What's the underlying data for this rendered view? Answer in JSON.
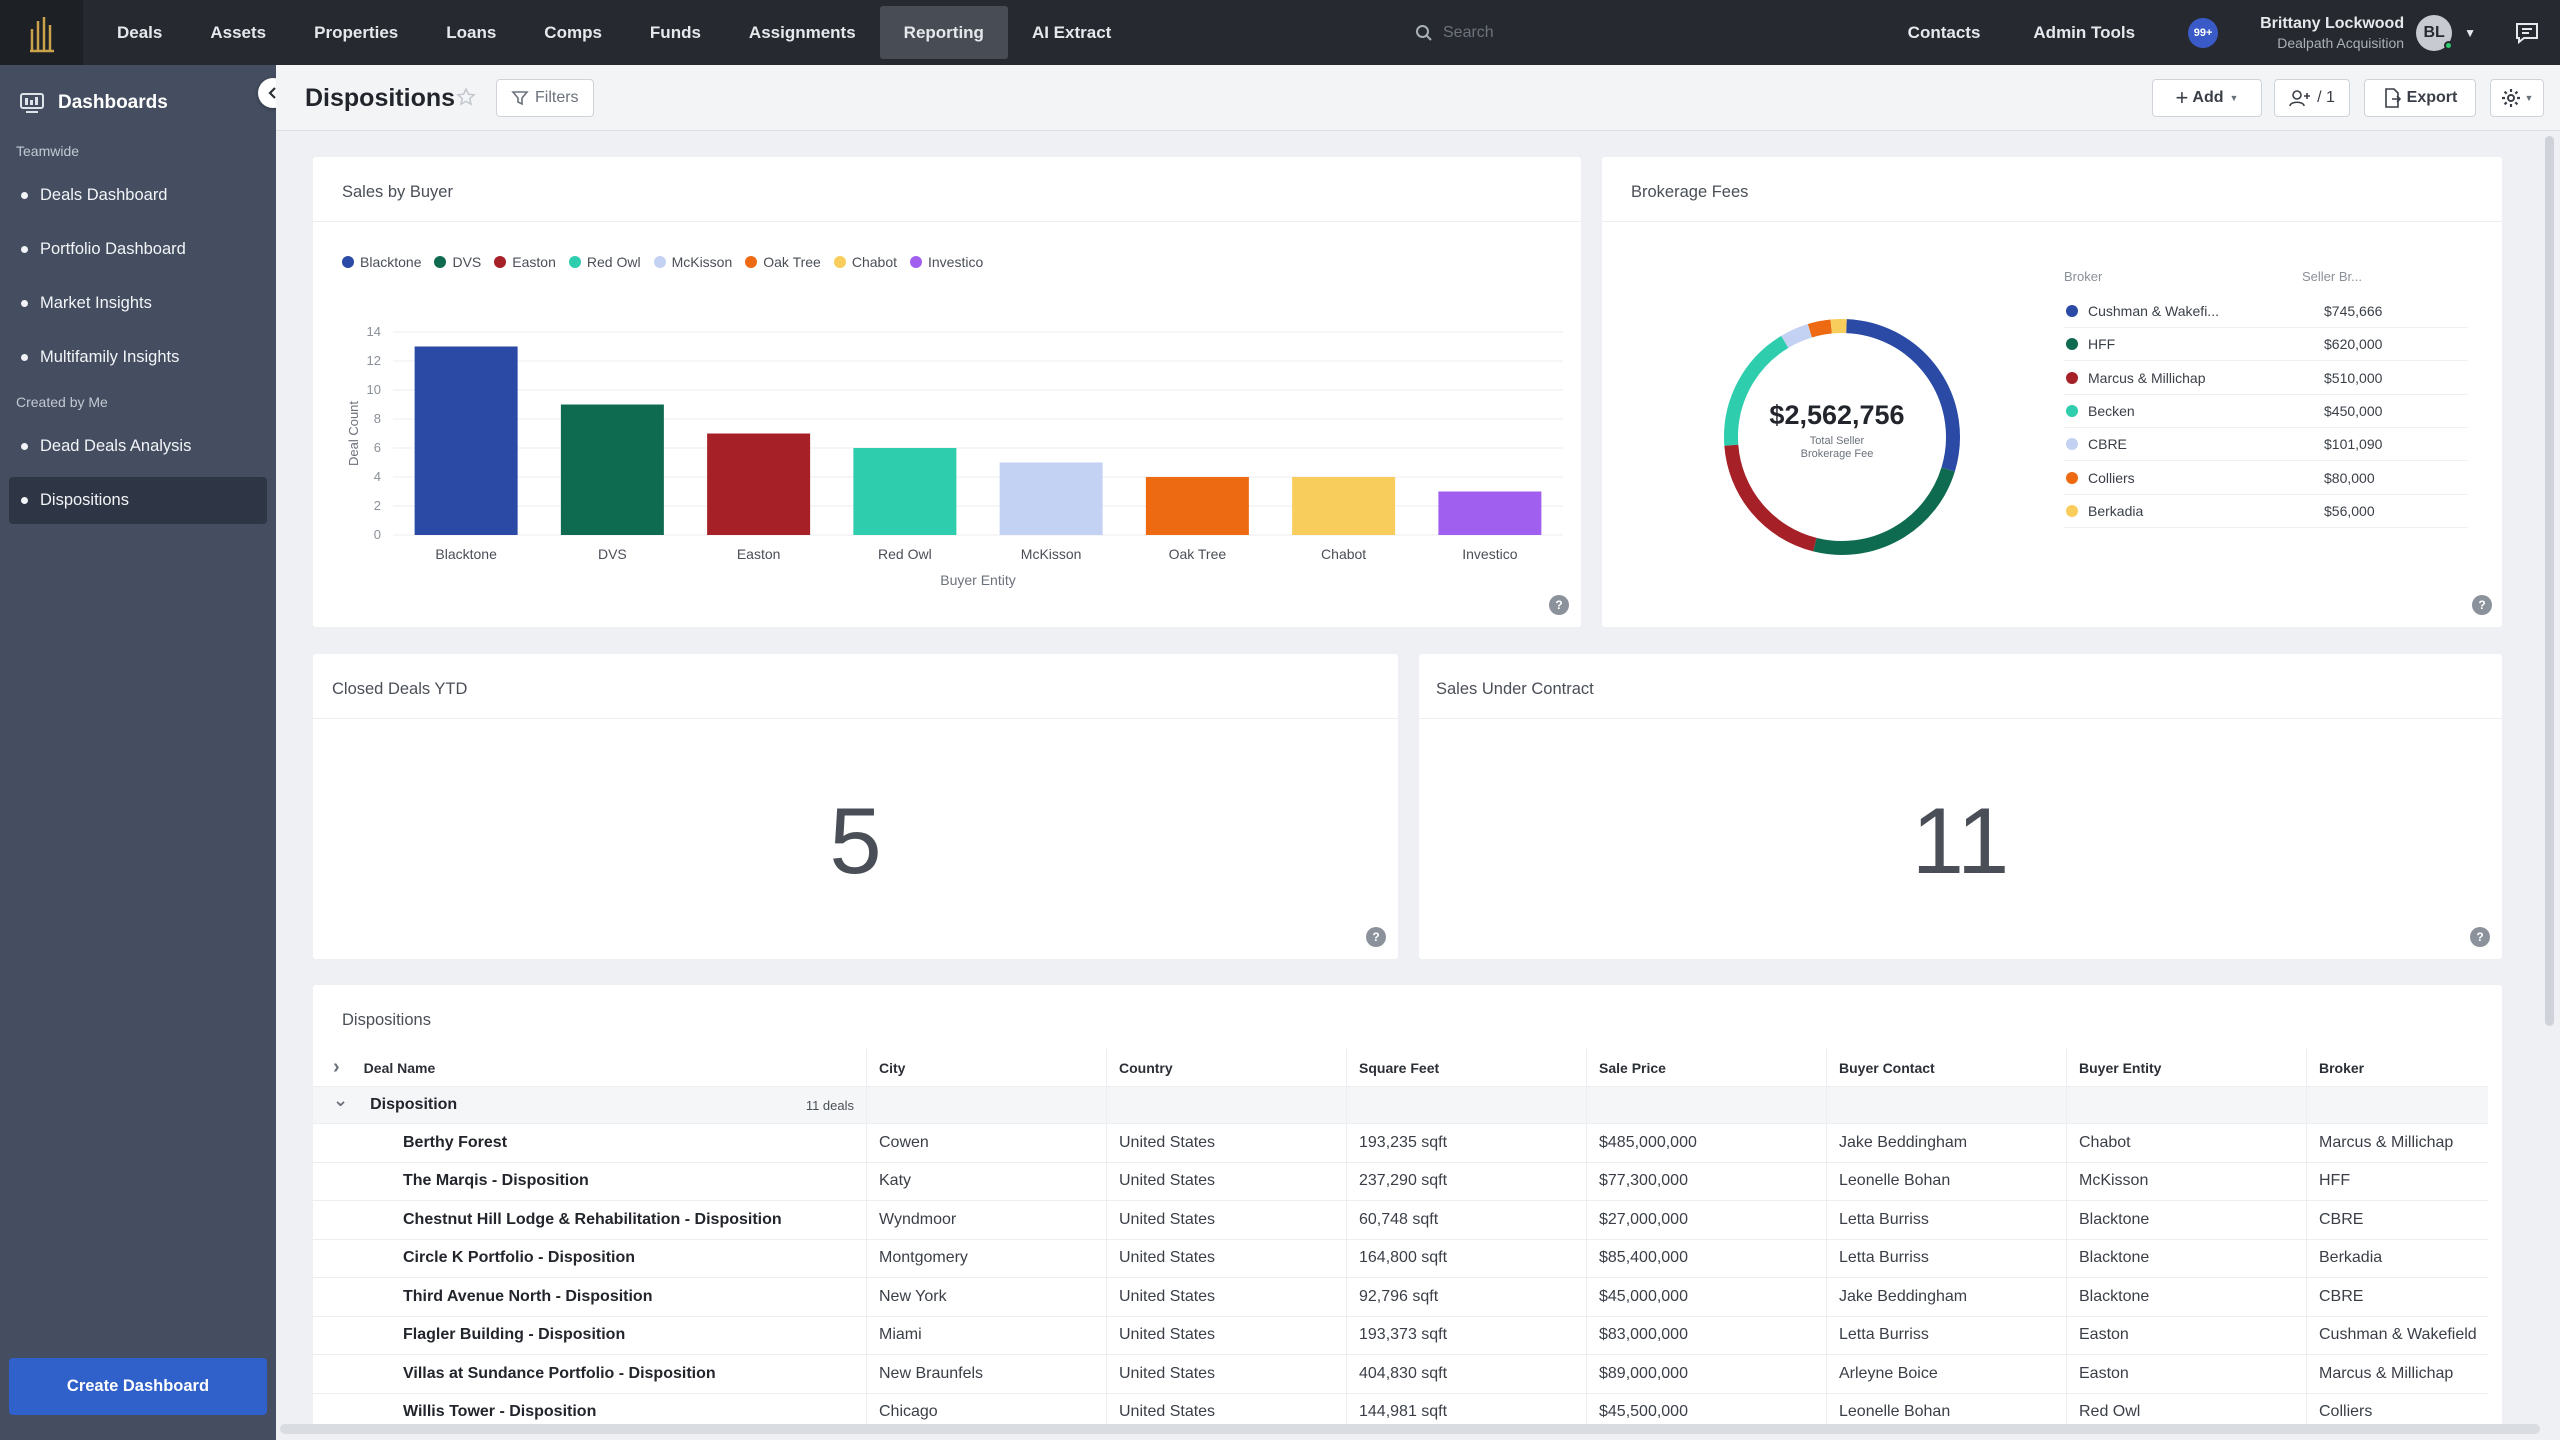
{
  "nav": {
    "items": [
      "Deals",
      "Assets",
      "Properties",
      "Loans",
      "Comps",
      "Funds",
      "Assignments",
      "Reporting",
      "AI Extract"
    ],
    "active": "Reporting",
    "search_placeholder": "Search",
    "contacts": "Contacts",
    "admin_tools": "Admin Tools",
    "notifications": "99+",
    "user_name": "Brittany Lockwood",
    "user_org": "Dealpath Acquisition",
    "user_initials": "BL"
  },
  "sidebar": {
    "title": "Dashboards",
    "section_teamwide": "Teamwide",
    "teamwide_items": [
      "Deals Dashboard",
      "Portfolio Dashboard",
      "Market Insights",
      "Multifamily Insights"
    ],
    "section_mine": "Created by Me",
    "mine_items": [
      "Dead Deals Analysis",
      "Dispositions"
    ],
    "active": "Dispositions",
    "create_button": "Create Dashboard"
  },
  "header": {
    "title": "Dispositions",
    "filters": "Filters",
    "add": "Add",
    "share_count": "/ 1",
    "export": "Export"
  },
  "colors": {
    "Blacktone": "#2a4aa5",
    "DVS": "#0f6b50",
    "Easton": "#a62028",
    "Red Owl": "#2ecdae",
    "McKisson": "#c3d2f3",
    "Oak Tree": "#ee6a12",
    "Chabot": "#f9cd5b",
    "Investico": "#a15ff0"
  },
  "sales_by_buyer": {
    "title": "Sales by Buyer",
    "chart_data": {
      "type": "bar",
      "categories": [
        "Blacktone",
        "DVS",
        "Easton",
        "Red Owl",
        "McKisson",
        "Oak Tree",
        "Chabot",
        "Investico"
      ],
      "values": [
        13,
        9,
        7,
        6,
        5,
        4,
        4,
        3
      ],
      "xlabel": "Buyer Entity",
      "ylabel": "Deal Count",
      "ylim": [
        0,
        14
      ],
      "yticks": [
        0,
        2,
        4,
        6,
        8,
        10,
        12,
        14
      ],
      "legend": [
        "Blacktone",
        "DVS",
        "Easton",
        "Red Owl",
        "McKisson",
        "Oak Tree",
        "Chabot",
        "Investico"
      ],
      "grid": true,
      "legend_position": "top-left"
    }
  },
  "brokerage_fees": {
    "title": "Brokerage Fees",
    "total": "$2,562,756",
    "total_label_1": "Total Seller",
    "total_label_2": "Brokerage Fee",
    "col_broker": "Broker",
    "col_fee": "Seller Br...",
    "chart_data": {
      "type": "pie",
      "labels": [
        "Cushman & Wakefi...",
        "HFF",
        "Marcus & Millichap",
        "Becken",
        "CBRE",
        "Colliers",
        "Berkadia"
      ],
      "values": [
        745666,
        620000,
        510000,
        450000,
        101090,
        80000,
        56000
      ],
      "display": [
        "$745,666",
        "$620,000",
        "$510,000",
        "$450,000",
        "$101,090",
        "$80,000",
        "$56,000"
      ],
      "colors": [
        "#2a4aa5",
        "#0f6b50",
        "#a62028",
        "#2ecdae",
        "#c3d2f3",
        "#ee6a12",
        "#f9cd5b"
      ]
    }
  },
  "closed_deals": {
    "title": "Closed Deals YTD",
    "value": "5"
  },
  "sales_under_contract": {
    "title": "Sales Under Contract",
    "value": "11"
  },
  "dispositions": {
    "title": "Dispositions",
    "columns": [
      "Deal Name",
      "City",
      "Country",
      "Square Feet",
      "Sale Price",
      "Buyer Contact",
      "Buyer Entity",
      "Broker"
    ],
    "group_label": "Disposition",
    "group_count": "11 deals",
    "rows": [
      [
        "Berthy Forest",
        "Cowen",
        "United States",
        "193,235 sqft",
        "$485,000,000",
        "Jake Beddingham",
        "Chabot",
        "Marcus & Millichap"
      ],
      [
        "The Marqis - Disposition",
        "Katy",
        "United States",
        "237,290 sqft",
        "$77,300,000",
        "Leonelle Bohan",
        "McKisson",
        "HFF"
      ],
      [
        "Chestnut Hill Lodge & Rehabilitation - Disposition",
        "Wyndmoor",
        "United States",
        "60,748 sqft",
        "$27,000,000",
        "Letta Burriss",
        "Blacktone",
        "CBRE"
      ],
      [
        "Circle K Portfolio - Disposition",
        "Montgomery",
        "United States",
        "164,800 sqft",
        "$85,400,000",
        "Letta Burriss",
        "Blacktone",
        "Berkadia"
      ],
      [
        "Third Avenue North - Disposition",
        "New York",
        "United States",
        "92,796 sqft",
        "$45,000,000",
        "Jake Beddingham",
        "Blacktone",
        "CBRE"
      ],
      [
        "Flagler Building - Disposition",
        "Miami",
        "United States",
        "193,373 sqft",
        "$83,000,000",
        "Letta Burriss",
        "Easton",
        "Cushman & Wakefield"
      ],
      [
        "Villas at Sundance Portfolio - Disposition",
        "New Braunfels",
        "United States",
        "404,830 sqft",
        "$89,000,000",
        "Arleyne Boice",
        "Easton",
        "Marcus & Millichap"
      ],
      [
        "Willis Tower - Disposition",
        "Chicago",
        "United States",
        "144,981 sqft",
        "$45,500,000",
        "Leonelle Bohan",
        "Red Owl",
        "Colliers"
      ]
    ]
  }
}
